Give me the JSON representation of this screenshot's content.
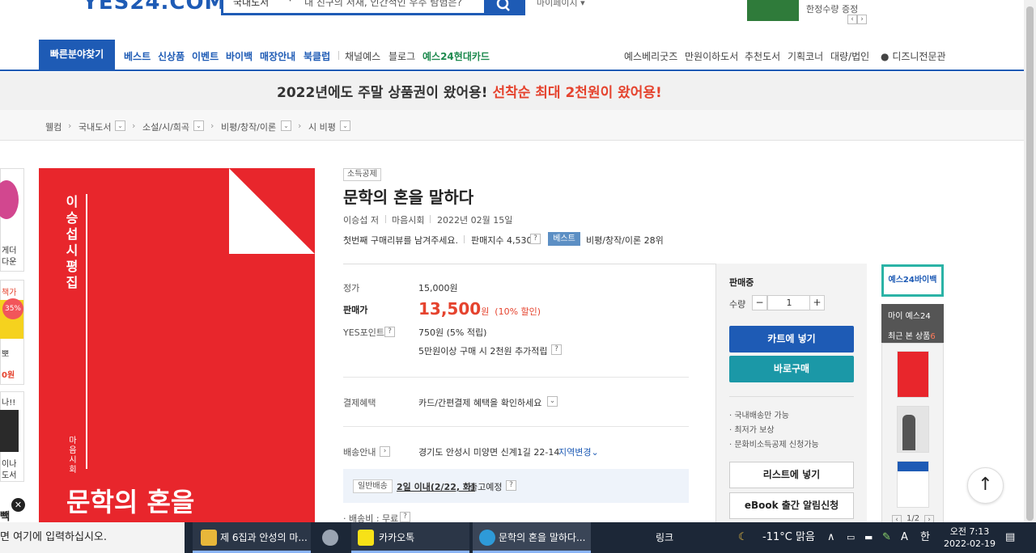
{
  "header": {
    "logo": "YES24.COM",
    "search_category": "국내도서",
    "search_placeholder": "내 친구의 서재, 인간적인 우주 탐험은?",
    "mypage": "마이페이지",
    "promo": "한정수량 증정"
  },
  "gnb": {
    "quick_find": "빠른분야찾기",
    "left_items": [
      "베스트",
      "신상품",
      "이벤트",
      "바이백",
      "매장안내",
      "북클럽",
      "채널예스",
      "블로그",
      "예스24현대카드"
    ],
    "right_items": [
      "예스베리굿즈",
      "만원이하도서",
      "추천도서",
      "기획코너",
      "대량/법인",
      "디즈니전문관"
    ]
  },
  "banner": {
    "text_main": "2022년에도 주말 상품권이 왔어용!",
    "text_highlight": "선착순 최대 2천원이 왔어용!"
  },
  "breadcrumb": [
    "웰컴",
    "국내도서",
    "소설/시/희곡",
    "비평/창작/이론",
    "시 비평"
  ],
  "left_side": {
    "snippets": [
      "게더",
      "다운",
      "책가",
      "35%",
      "뽀",
      "0원",
      "나!!",
      "이나",
      "도서",
      "빽"
    ]
  },
  "cover": {
    "author_vertical": "이승섭 시평집",
    "publisher_vertical": "마음시회",
    "title": "문학의 혼을"
  },
  "product": {
    "badge": "소득공제",
    "title": "문학의 혼을 말하다",
    "author": "이승섭 저",
    "publisher": "마음시회",
    "date": "2022년 02월 15일",
    "review_prompt": "첫번째 구매리뷰를 남겨주세요.",
    "sales_index": "판매지수 4,530",
    "best_tag": "베스트",
    "best_rank": "비평/창작/이론 28위",
    "list_price_label": "정가",
    "list_price": "15,000원",
    "sale_price_label": "판매가",
    "sale_price": "13,500",
    "sale_unit": "원",
    "discount": "(10% 할인)",
    "yes_point_label": "YES포인트",
    "yes_point": "750원 (5% 적립)",
    "extra_point": "5만원이상 구매 시 2천원 추가적립",
    "payment_label": "결제혜택",
    "payment_value": "카드/간편결제 혜택을 확인하세요",
    "shipping_label": "배송안내",
    "shipping_address": "경기도 안성시 미양면 신계1길 22-14",
    "region_change": "지역변경",
    "ship_tag": "일반배송",
    "ship_date": "2일 이내(2/22, 화)",
    "ship_suffix": "출고예정",
    "shipping_fee": "· 배송비 : 무료"
  },
  "buybox": {
    "status": "판매중",
    "qty_label": "수량",
    "qty_minus": "−",
    "qty_value": "1",
    "qty_plus": "+",
    "cart": "카트에 넣기",
    "buy_now": "바로구매",
    "bullets": [
      "· 국내배송만 가능",
      "· 최저가 보상",
      "· 문화비소득공제 신청가능"
    ],
    "wishlist": "리스트에 넣기",
    "ebook_alert": "eBook 출간 알림신청"
  },
  "rail": {
    "logo": "예스24바이백",
    "my_yes24": "마이 예스24",
    "recent": "최근 본 상품",
    "recent_count": "6",
    "pager": "1/2"
  },
  "taskbar": {
    "search_text": "면 여기에 입력하십시오.",
    "items": [
      "제 6집과 안성의 마...",
      "카카오톡",
      "문학의 혼을 말하다..."
    ],
    "link": "링크",
    "temp": "-11°C",
    "weather": "맑음",
    "ime": "A",
    "ime_kor": "한",
    "time": "오전 7:13",
    "date": "2022-02-19"
  },
  "colors": {
    "brand_blue": "#1e5bb5",
    "teal": "#1b98a7",
    "price_red": "#e5432e",
    "cover_red": "#e8262c"
  }
}
